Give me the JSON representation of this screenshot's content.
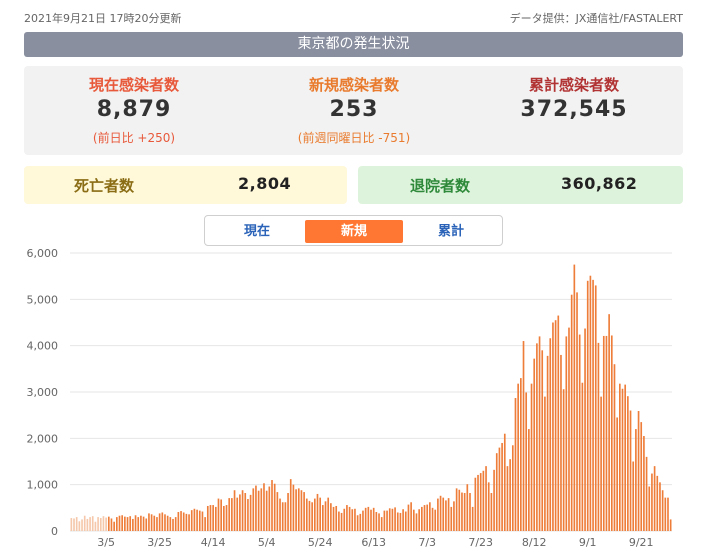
{
  "header": {
    "updated": "2021年9月21日 17時20分更新",
    "provider": "データ提供：JX通信社/FASTALERT"
  },
  "title": "東京都の発生状況",
  "stats": {
    "current": {
      "label": "現在感染者数",
      "value": "8,879",
      "sub": "(前日比 +250)"
    },
    "new": {
      "label": "新規感染者数",
      "value": "253",
      "sub": "(前週同曜日比 -751)"
    },
    "total": {
      "label": "累計感染者数",
      "value": "372,545"
    }
  },
  "deaths": {
    "label": "死亡者数",
    "value": "2,804"
  },
  "recovered": {
    "label": "退院者数",
    "value": "360,862"
  },
  "tabs": [
    {
      "label": "現在",
      "active": false
    },
    {
      "label": "新規",
      "active": true
    },
    {
      "label": "累計",
      "active": false
    }
  ],
  "colors": {
    "bar": "#ee7d3a",
    "bar_early": "#f5c8ab",
    "active_tab": "#ff7733",
    "tab_text": "#2a63b8"
  },
  "chart_data": {
    "type": "bar",
    "x_tick_labels": [
      "3/5",
      "3/25",
      "4/14",
      "5/4",
      "5/24",
      "6/13",
      "7/3",
      "7/23",
      "8/12",
      "9/1",
      "9/21"
    ],
    "y_tick_labels": [
      "0",
      "1,000",
      "2,000",
      "3,000",
      "4,000",
      "5,000",
      "6,000"
    ],
    "ylim": [
      0,
      6000
    ],
    "x_range": [
      "2021-02-20",
      "2021-09-21"
    ],
    "grid": true,
    "values": [
      280,
      270,
      300,
      210,
      250,
      330,
      260,
      300,
      320,
      200,
      300,
      280,
      320,
      290,
      310,
      270,
      200,
      300,
      330,
      340,
      310,
      300,
      320,
      260,
      340,
      300,
      330,
      310,
      270,
      380,
      360,
      330,
      300,
      380,
      400,
      360,
      330,
      300,
      260,
      300,
      410,
      430,
      400,
      370,
      360,
      450,
      480,
      460,
      440,
      420,
      300,
      540,
      560,
      560,
      520,
      700,
      680,
      540,
      560,
      710,
      710,
      880,
      720,
      790,
      880,
      820,
      690,
      780,
      920,
      980,
      870,
      920,
      1030,
      870,
      960,
      1100,
      1020,
      840,
      700,
      620,
      620,
      820,
      1120,
      1000,
      900,
      920,
      880,
      840,
      700,
      650,
      620,
      700,
      800,
      720,
      560,
      640,
      720,
      600,
      520,
      540,
      420,
      390,
      480,
      560,
      520,
      470,
      480,
      340,
      370,
      440,
      500,
      520,
      460,
      500,
      410,
      380,
      300,
      440,
      440,
      490,
      480,
      510,
      400,
      390,
      470,
      420,
      570,
      620,
      460,
      380,
      470,
      520,
      560,
      570,
      620,
      500,
      460,
      700,
      760,
      720,
      660,
      710,
      520,
      640,
      920,
      890,
      830,
      820,
      1010,
      820,
      520,
      1150,
      1210,
      1250,
      1300,
      1400,
      1050,
      820,
      1320,
      1680,
      1800,
      1900,
      2100,
      1400,
      1550,
      1850,
      2870,
      3180,
      3300,
      4100,
      2990,
      2200,
      3180,
      3720,
      4050,
      4200,
      3900,
      2900,
      3780,
      4160,
      4500,
      4550,
      4650,
      3800,
      3060,
      4200,
      4390,
      5100,
      5750,
      5150,
      4240,
      3200,
      4370,
      5400,
      5510,
      5420,
      5300,
      4060,
      2900,
      4210,
      4210,
      4680,
      4220,
      3600,
      2450,
      3180,
      3070,
      3160,
      2910,
      2600,
      1500,
      2200,
      2590,
      2350,
      2050,
      1600,
      960,
      1240,
      1400,
      1190,
      1050,
      880,
      720,
      720,
      250
    ]
  }
}
